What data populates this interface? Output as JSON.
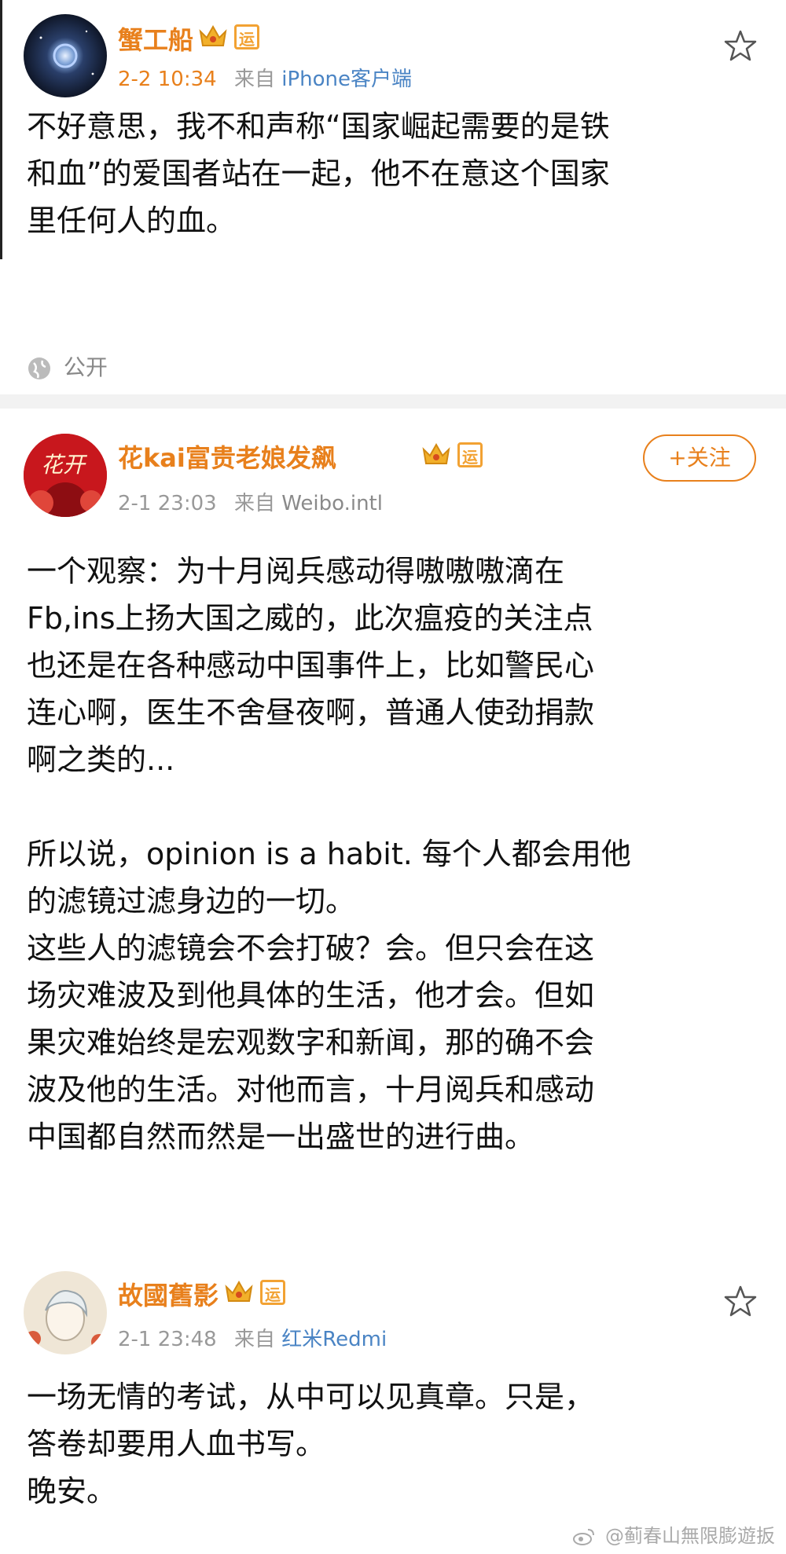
{
  "posts": [
    {
      "username": "蟹工船",
      "time": "2-2 10:34",
      "from_prefix": "来自",
      "source": "iPhone客户端",
      "badge_text": "运",
      "content": "不好意思，我不和声称“国家崛起需要的是铁\n和血”的爱国者站在一起，他不在意这个国家\n里任何人的血。",
      "visibility_label": "公开"
    },
    {
      "username": "花kai富贵老娘发飙",
      "time": "2-1 23:03",
      "from_prefix": "来自",
      "source": "Weibo.intl",
      "badge_text": "运",
      "follow_label": "+关注",
      "avatar_text": "花开",
      "content": "一个观察：为十月阅兵感动得嗷嗷嗷滴在\nFb,ins上扬大国之威的，此次瘟疫的关注点\n也还是在各种感动中国事件上，比如警民心\n连心啊，医生不舍昼夜啊，普通人使劲捐款\n啊之类的...\n\n所以说，opinion is a habit. 每个人都会用他\n的滤镜过滤身边的一切。\n这些人的滤镜会不会打破？会。但只会在这\n场灾难波及到他具体的生活，他才会。但如\n果灾难始终是宏观数字和新闻，那的确不会\n波及他的生活。对他而言，十月阅兵和感动\n中国都自然而然是一出盛世的进行曲。"
    },
    {
      "username": "故國舊影",
      "time": "2-1 23:48",
      "from_prefix": "来自",
      "source": "红米Redmi",
      "badge_text": "运",
      "content": "一场无情的考试，从中可以见真章。只是，\n答卷却要用人血书写。\n晚安。"
    }
  ],
  "watermark": "@蓟春山無限膨遊扳",
  "colors": {
    "name": "#e8801c",
    "meta": "#999999",
    "link": "#4a84c4",
    "divider": "#f2f2f2"
  },
  "icons": [
    "crown-icon",
    "star-icon",
    "globe-icon",
    "weibo-icon"
  ]
}
